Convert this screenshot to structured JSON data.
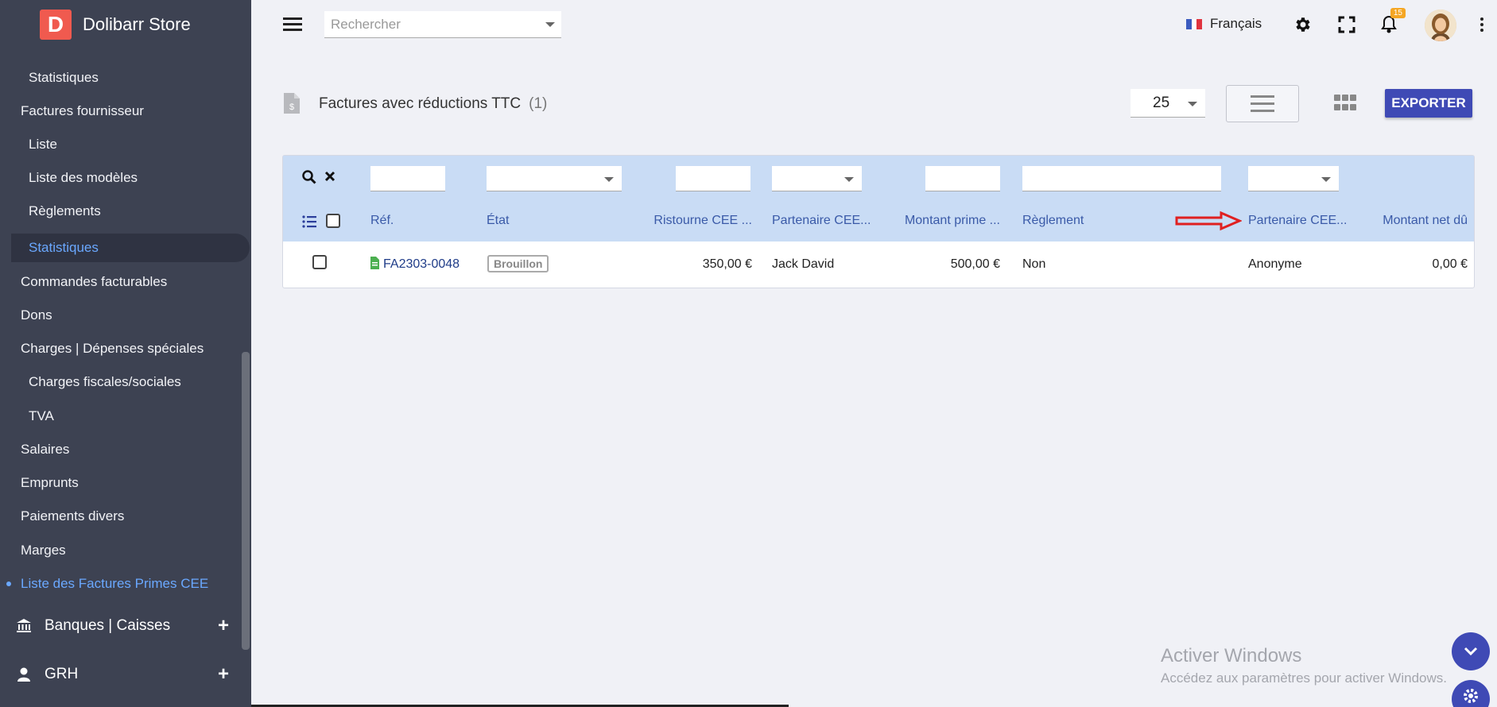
{
  "app": {
    "logo_letter": "D",
    "name": "Dolibarr Store"
  },
  "sidebar": {
    "items": [
      {
        "label": "Statistiques"
      },
      {
        "label": "Factures fournisseur"
      },
      {
        "label": "Liste"
      },
      {
        "label": "Liste des modèles"
      },
      {
        "label": "Règlements"
      },
      {
        "label": "Statistiques"
      },
      {
        "label": "Commandes facturables"
      },
      {
        "label": "Dons"
      },
      {
        "label": "Charges | Dépenses spéciales"
      },
      {
        "label": "Charges fiscales/sociales"
      },
      {
        "label": "TVA"
      },
      {
        "label": "Salaires"
      },
      {
        "label": "Emprunts"
      },
      {
        "label": "Paiements divers"
      },
      {
        "label": "Marges"
      },
      {
        "label": "Liste des Factures Primes CEE"
      }
    ],
    "groups": [
      {
        "label": "Banques | Caisses",
        "icon": "bank-icon"
      },
      {
        "label": "GRH",
        "icon": "user-icon"
      }
    ]
  },
  "topbar": {
    "search_placeholder": "Rechercher",
    "language": "Français",
    "notification_count": "15"
  },
  "page": {
    "title": "Factures avec réductions TTC",
    "count": "(1)",
    "per_page": "25",
    "export_label": "EXPORTER"
  },
  "table": {
    "columns": [
      "Réf.",
      "État",
      "Ristourne CEE ...",
      "Partenaire CEE...",
      "Montant prime ...",
      "Règlement",
      "Partenaire CEE...",
      "Montant net dû"
    ],
    "rows": [
      {
        "ref": "FA2303-0048",
        "status": "Brouillon",
        "ristourne": "350,00 €",
        "partenaire1": "Jack David",
        "montant_prime": "500,00 €",
        "reglement": "Non",
        "partenaire2": "Anonyme",
        "montant_net": "0,00 €"
      }
    ]
  },
  "watermark": {
    "title": "Activer Windows",
    "subtitle": "Accédez aux paramètres pour activer Windows."
  },
  "colors": {
    "sidebar_bg": "#3d4252",
    "accent": "#3f4ab5",
    "link_active": "#6aa8ff",
    "table_header_bg": "#c9dcf5",
    "annotation_arrow": "#e02020"
  }
}
